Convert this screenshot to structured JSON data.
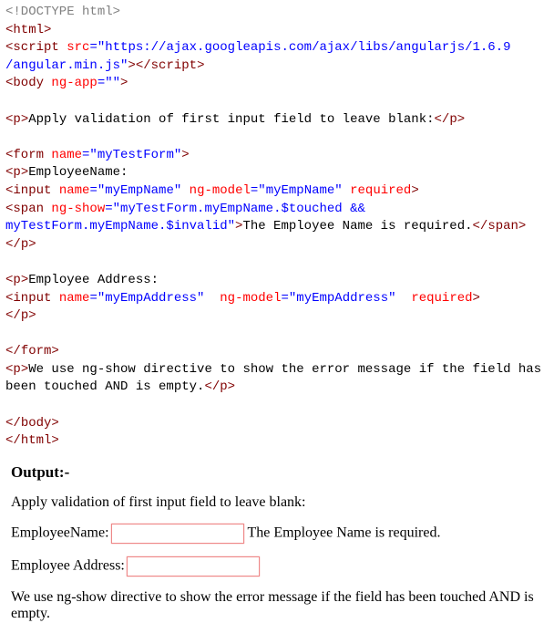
{
  "code": {
    "l1_doctype": "<!DOCTYPE html>",
    "l2_a": "<",
    "l2_b": "html",
    "l2_c": ">",
    "l3_a": "<",
    "l3_b": "script",
    "l3_c": " src",
    "l3_d": "=\"https://ajax.googleapis.com/ajax/libs/angularjs/1.6.9",
    "l4_a": "/angular.min.js\"",
    "l4_b": "></",
    "l4_c": "script",
    "l4_d": ">",
    "l5_a": "<",
    "l5_b": "body",
    "l5_c": " ng-app",
    "l5_d": "=\"\"",
    "l5_e": ">",
    "l7_a": "<",
    "l7_b": "p",
    "l7_c": ">",
    "l7_d": "Apply validation of first input field to leave blank:",
    "l7_e": "</",
    "l7_f": "p",
    "l7_g": ">",
    "l9_a": "<",
    "l9_b": "form",
    "l9_c": " name",
    "l9_d": "=\"myTestForm\"",
    "l9_e": ">",
    "l10_a": "<",
    "l10_b": "p",
    "l10_c": ">",
    "l10_d": "EmployeeName:",
    "l11_a": "<",
    "l11_b": "input",
    "l11_c": " name",
    "l11_d": "=\"myEmpName\"",
    "l11_e": " ng-model",
    "l11_f": "=\"myEmpName\"",
    "l11_g": " required",
    "l11_h": ">",
    "l12_a": "<",
    "l12_b": "span",
    "l12_c": " ng-show",
    "l12_d": "=\"myTestForm.myEmpName.$touched && ",
    "l13_a": "myTestForm.myEmpName.$invalid\"",
    "l13_b": ">",
    "l13_c": "The Employee Name is required.",
    "l13_d": "</",
    "l13_e": "span",
    "l13_f": ">",
    "l14_a": "</",
    "l14_b": "p",
    "l14_c": ">",
    "l16_a": "<",
    "l16_b": "p",
    "l16_c": ">",
    "l16_d": "Employee Address:",
    "l17_a": "<",
    "l17_b": "input",
    "l17_c": " name",
    "l17_d": "=\"myEmpAddress\"",
    "l17_e": "  ng-model",
    "l17_f": "=\"myEmpAddress\"",
    "l17_g": "  required",
    "l17_h": ">",
    "l18_a": "</",
    "l18_b": "p",
    "l18_c": ">",
    "l20_a": "</",
    "l20_b": "form",
    "l20_c": ">",
    "l21_a": "<",
    "l21_b": "p",
    "l21_c": ">",
    "l21_d": "We use ng-show directive to show the error message if the field has been touched AND is empty.",
    "l21_e": "</",
    "l21_f": "p",
    "l21_g": ">",
    "l23_a": "</",
    "l23_b": "body",
    "l23_c": ">",
    "l24_a": "</",
    "l24_b": "html",
    "l24_c": ">"
  },
  "output": {
    "heading": "Output:-",
    "p1": "Apply validation of first input field to leave blank:",
    "label_name": "EmployeeName:",
    "msg_name": "The Employee Name is required.",
    "label_addr": "Employee Address:",
    "p2": "We use ng-show directive to show the error message if the field has been touched AND is empty."
  }
}
